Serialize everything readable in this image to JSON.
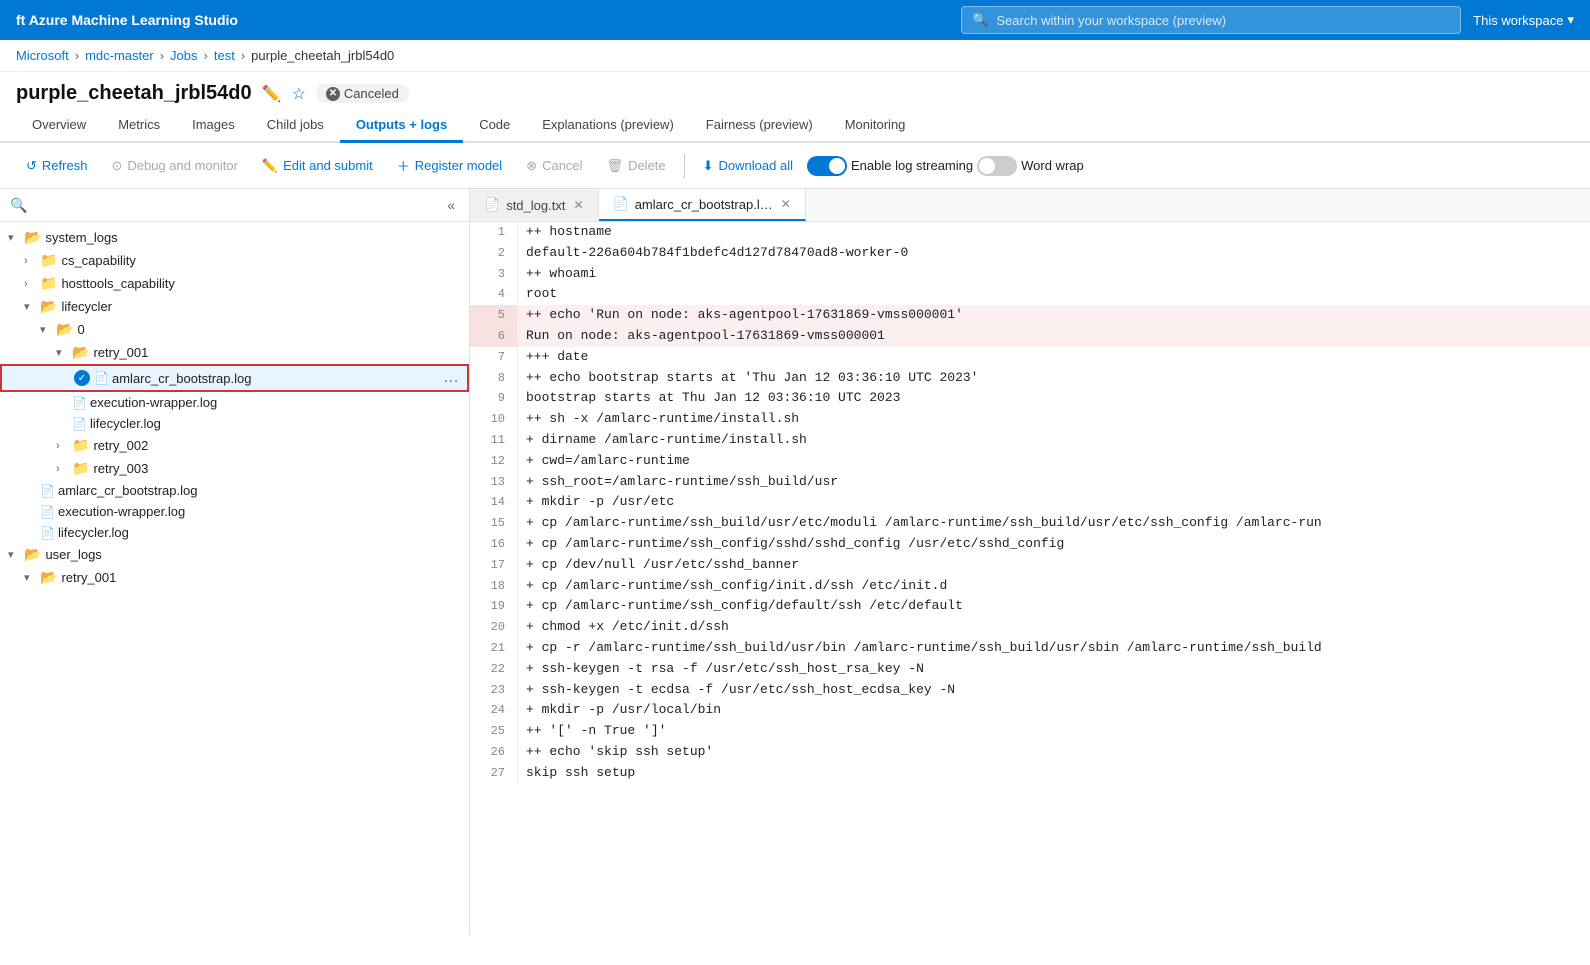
{
  "topbar": {
    "logo": "ft Azure Machine Learning Studio",
    "search_placeholder": "Search within your workspace (preview)",
    "workspace_label": "This workspace"
  },
  "breadcrumb": {
    "items": [
      {
        "label": "Microsoft",
        "link": true
      },
      {
        "label": "mdc-master",
        "link": true
      },
      {
        "label": "Jobs",
        "link": true
      },
      {
        "label": "test",
        "link": true
      },
      {
        "label": "purple_cheetah_jrbl54d0",
        "link": false
      }
    ]
  },
  "page": {
    "title": "purple_cheetah_jrbl54d0",
    "status": "Canceled"
  },
  "tabs": [
    {
      "label": "Overview",
      "active": false
    },
    {
      "label": "Metrics",
      "active": false
    },
    {
      "label": "Images",
      "active": false
    },
    {
      "label": "Child jobs",
      "active": false
    },
    {
      "label": "Outputs + logs",
      "active": true
    },
    {
      "label": "Code",
      "active": false
    },
    {
      "label": "Explanations (preview)",
      "active": false
    },
    {
      "label": "Fairness (preview)",
      "active": false
    },
    {
      "label": "Monitoring",
      "active": false
    }
  ],
  "toolbar": {
    "refresh": "Refresh",
    "debug": "Debug and monitor",
    "edit": "Edit and submit",
    "register": "Register model",
    "cancel": "Cancel",
    "delete": "Delete",
    "download_all": "Download all",
    "enable_log_streaming": "Enable log streaming",
    "word_wrap": "Word wrap"
  },
  "file_tree": [
    {
      "id": "system_logs",
      "label": "system_logs",
      "type": "folder",
      "level": 0,
      "open": true,
      "chevron": "▾"
    },
    {
      "id": "cs_capability",
      "label": "cs_capability",
      "type": "folder",
      "level": 1,
      "open": false,
      "chevron": "›"
    },
    {
      "id": "hosttools_capability",
      "label": "hosttools_capability",
      "type": "folder",
      "level": 1,
      "open": false,
      "chevron": "›"
    },
    {
      "id": "lifecycler",
      "label": "lifecycler",
      "type": "folder",
      "level": 1,
      "open": true,
      "chevron": "▾"
    },
    {
      "id": "0",
      "label": "0",
      "type": "folder",
      "level": 2,
      "open": true,
      "chevron": "▾"
    },
    {
      "id": "retry_001_inner",
      "label": "retry_001",
      "type": "folder-open",
      "level": 3,
      "open": true,
      "chevron": "▾"
    },
    {
      "id": "amlarc_cr_bootstrap_log",
      "label": "amlarc_cr_bootstrap.log",
      "type": "file",
      "level": 4,
      "active": true,
      "ellipsis": true,
      "checked": true
    },
    {
      "id": "execution_wrapper_log",
      "label": "execution-wrapper.log",
      "type": "file",
      "level": 4
    },
    {
      "id": "lifecycler_log_inner",
      "label": "lifecycler.log",
      "type": "file",
      "level": 4
    },
    {
      "id": "retry_002",
      "label": "retry_002",
      "type": "folder",
      "level": 3,
      "open": false,
      "chevron": "›"
    },
    {
      "id": "retry_003",
      "label": "retry_003",
      "type": "folder",
      "level": 3,
      "open": false,
      "chevron": "›"
    },
    {
      "id": "amlarc_cr_bootstrap_log2",
      "label": "amlarc_cr_bootstrap.log",
      "type": "file",
      "level": 2
    },
    {
      "id": "execution_wrapper_log2",
      "label": "execution-wrapper.log",
      "type": "file",
      "level": 2
    },
    {
      "id": "lifecycler_log2",
      "label": "lifecycler.log",
      "type": "file",
      "level": 2
    },
    {
      "id": "user_logs",
      "label": "user_logs",
      "type": "folder",
      "level": 0,
      "open": true,
      "chevron": "▾"
    },
    {
      "id": "retry_001_outer",
      "label": "retry_001",
      "type": "folder",
      "level": 1,
      "open": true,
      "chevron": "▾"
    }
  ],
  "code_tabs": [
    {
      "label": "std_log.txt",
      "active": false,
      "closeable": true
    },
    {
      "label": "amlarc_cr_bootstrap.l…",
      "active": true,
      "closeable": true
    }
  ],
  "code_lines": [
    {
      "num": 1,
      "text": "++ hostname",
      "highlight": false
    },
    {
      "num": 2,
      "text": "default-226a604b784f1bdefc4d127d78470ad8-worker-0",
      "highlight": false
    },
    {
      "num": 3,
      "text": "++ whoami",
      "highlight": false
    },
    {
      "num": 4,
      "text": "root",
      "highlight": false
    },
    {
      "num": 5,
      "text": "++ echo 'Run on node: aks-agentpool-17631869-vmss000001'",
      "highlight": true,
      "border_top": true
    },
    {
      "num": 6,
      "text": "Run on node: aks-agentpool-17631869-vmss000001",
      "highlight": true,
      "border_bottom": true
    },
    {
      "num": 7,
      "text": "+++ date",
      "highlight": false
    },
    {
      "num": 8,
      "text": "++ echo bootstrap starts at 'Thu Jan 12 03:36:10 UTC 2023'",
      "highlight": false
    },
    {
      "num": 9,
      "text": "bootstrap starts at Thu Jan 12 03:36:10 UTC 2023",
      "highlight": false
    },
    {
      "num": 10,
      "text": "++ sh -x /amlarc-runtime/install.sh",
      "highlight": false
    },
    {
      "num": 11,
      "text": "+ dirname /amlarc-runtime/install.sh",
      "highlight": false
    },
    {
      "num": 12,
      "text": "+ cwd=/amlarc-runtime",
      "highlight": false
    },
    {
      "num": 13,
      "text": "+ ssh_root=/amlarc-runtime/ssh_build/usr",
      "highlight": false
    },
    {
      "num": 14,
      "text": "+ mkdir -p /usr/etc",
      "highlight": false
    },
    {
      "num": 15,
      "text": "+ cp /amlarc-runtime/ssh_build/usr/etc/moduli /amlarc-runtime/ssh_build/usr/etc/ssh_config /amlarc-run",
      "highlight": false
    },
    {
      "num": 16,
      "text": "+ cp /amlarc-runtime/ssh_config/sshd/sshd_config /usr/etc/sshd_config",
      "highlight": false
    },
    {
      "num": 17,
      "text": "+ cp /dev/null /usr/etc/sshd_banner",
      "highlight": false
    },
    {
      "num": 18,
      "text": "+ cp /amlarc-runtime/ssh_config/init.d/ssh /etc/init.d",
      "highlight": false
    },
    {
      "num": 19,
      "text": "+ cp /amlarc-runtime/ssh_config/default/ssh /etc/default",
      "highlight": false
    },
    {
      "num": 20,
      "text": "+ chmod +x /etc/init.d/ssh",
      "highlight": false
    },
    {
      "num": 21,
      "text": "+ cp -r /amlarc-runtime/ssh_build/usr/bin /amlarc-runtime/ssh_build/usr/sbin /amlarc-runtime/ssh_build",
      "highlight": false
    },
    {
      "num": 22,
      "text": "+ ssh-keygen -t rsa -f /usr/etc/ssh_host_rsa_key -N",
      "highlight": false
    },
    {
      "num": 23,
      "text": "+ ssh-keygen -t ecdsa -f /usr/etc/ssh_host_ecdsa_key -N",
      "highlight": false
    },
    {
      "num": 24,
      "text": "+ mkdir -p /usr/local/bin",
      "highlight": false
    },
    {
      "num": 25,
      "text": "++ '[' -n True ']'",
      "highlight": false
    },
    {
      "num": 26,
      "text": "++ echo 'skip ssh setup'",
      "highlight": false
    },
    {
      "num": 27,
      "text": "skip ssh setup",
      "highlight": false
    }
  ]
}
